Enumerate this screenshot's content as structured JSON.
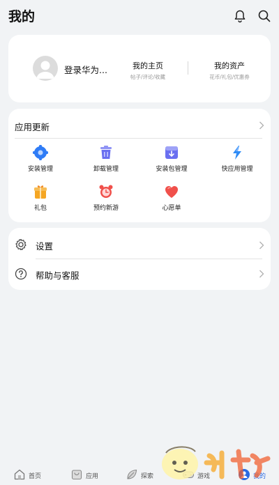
{
  "header": {
    "title": "我的",
    "icons": [
      "bell-icon",
      "search-icon"
    ]
  },
  "profile": {
    "login_text": "登录华为...",
    "home": {
      "title": "我的主页",
      "subtitle": "帖子/评论/收藏"
    },
    "assets": {
      "title": "我的资产",
      "subtitle": "花币/礼包/优惠券"
    }
  },
  "apps_section": {
    "title": "应用更新",
    "items": [
      {
        "label": "安装管理",
        "icon": "gear-icon",
        "color": "#2f7cf6"
      },
      {
        "label": "卸载管理",
        "icon": "trash-icon",
        "color": "#6a6ff0"
      },
      {
        "label": "安装包管理",
        "icon": "package-icon",
        "color": "#6a6ff0"
      },
      {
        "label": "快应用管理",
        "icon": "lightning-icon",
        "color": "#2f8cf6"
      },
      {
        "label": "礼包",
        "icon": "gift-icon",
        "color": "#f5a623"
      },
      {
        "label": "预约新游",
        "icon": "alarm-clock-icon",
        "color": "#f0504b"
      },
      {
        "label": "心愿单",
        "icon": "heart-icon",
        "color": "#f0504b"
      }
    ]
  },
  "settings_section": {
    "items": [
      {
        "label": "设置",
        "icon": "gear-outline-icon"
      },
      {
        "label": "帮助与客服",
        "icon": "help-icon"
      }
    ]
  },
  "tabbar": {
    "tabs": [
      {
        "label": "首页",
        "icon": "home-icon",
        "active": false
      },
      {
        "label": "应用",
        "icon": "bag-icon",
        "active": false
      },
      {
        "label": "探索",
        "icon": "leaf-icon",
        "active": false
      },
      {
        "label": "游戏",
        "icon": "gamepad-icon",
        "active": false
      },
      {
        "label": "我的",
        "icon": "user-icon",
        "active": true
      }
    ]
  },
  "colors": {
    "background": "#f1f3f5",
    "card": "#ffffff",
    "accent": "#2a6ae3"
  }
}
